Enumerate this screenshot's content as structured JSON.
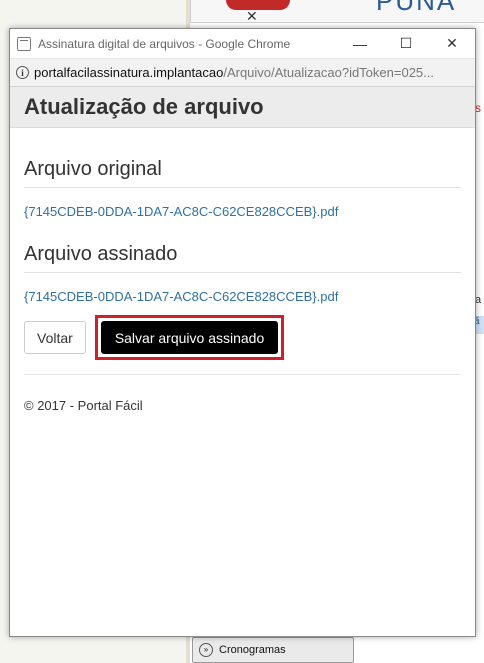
{
  "background": {
    "logo_text": "PUNA",
    "right_fragment_red": "s",
    "right_fragment_a": "a",
    "right_fragment_box": "ã",
    "bottom_tab_label": "Cronogramas",
    "bottom_tab_icon": "double-chevron-icon"
  },
  "window": {
    "title": "Assinatura digital de arquivos - Google Chrome",
    "minimize_glyph": "—",
    "maximize_glyph": "☐",
    "close_glyph": "✕"
  },
  "address": {
    "host": "portalfacilassinatura.implantacao",
    "path": "/Arquivo/Atualizacao?idToken=025..."
  },
  "page": {
    "heading": "Atualização de arquivo",
    "original_title": "Arquivo original",
    "original_file": "{7145CDEB-0DDA-1DA7-AC8C-C62CE828CCEB}.pdf",
    "signed_title": "Arquivo assinado",
    "signed_file": "{7145CDEB-0DDA-1DA7-AC8C-C62CE828CCEB}.pdf",
    "back_button": "Voltar",
    "save_button": "Salvar arquivo assinado",
    "highlight_color": "#d0202b",
    "footer": "© 2017 - Portal Fácil"
  }
}
